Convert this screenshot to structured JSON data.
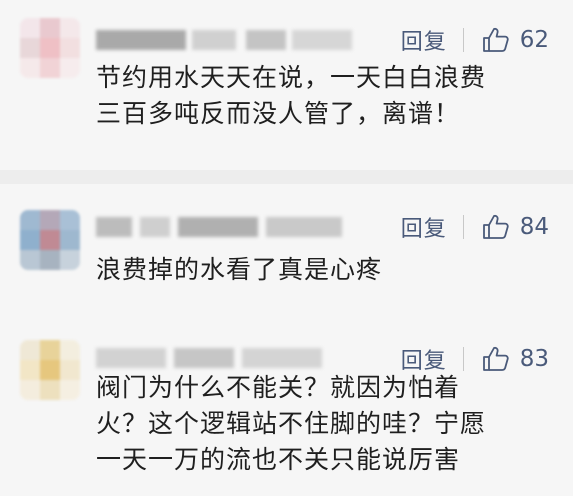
{
  "comments": [
    {
      "reply_label": "回复",
      "like_count": "62",
      "content_lines": [
        "节约用水天天在说，一天白白浪费",
        "三百多吨反而没人管了，离谱！"
      ]
    },
    {
      "reply_label": "回复",
      "like_count": "84",
      "content_lines": [
        "浪费掉的水看了真是心疼"
      ]
    },
    {
      "reply_label": "回复",
      "like_count": "83",
      "content_lines": [
        "阀门为什么不能关？就因为怕着",
        "火？这个逻辑站不住脚的哇？宁愿",
        "一天一万的流也不关只能说厉害"
      ]
    }
  ],
  "colors": {
    "text": "#1f1f1f",
    "action": "#4a5a7a",
    "background": "#f6f6f6",
    "separator": "#ededed"
  },
  "icons": {
    "like": "thumbs-up-outline-icon"
  }
}
